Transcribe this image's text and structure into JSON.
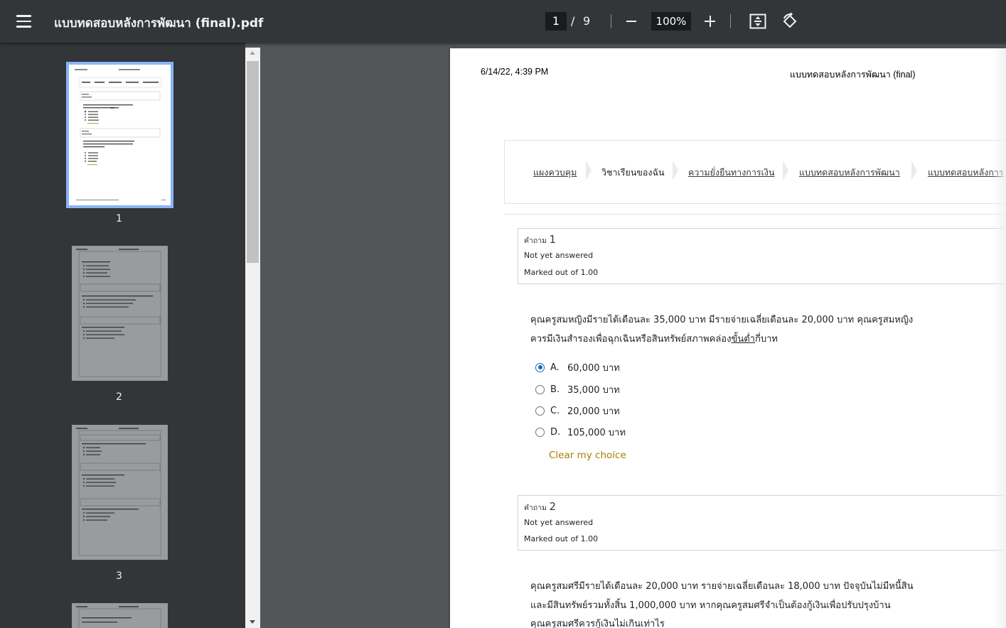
{
  "toolbar": {
    "title": "แบบทดสอบหลังการพัฒนา (final).pdf",
    "current_page": "1",
    "page_separator": "/",
    "total_pages": "9",
    "zoom": "100%"
  },
  "sidebar": {
    "thumbnails": [
      {
        "label": "1",
        "active": true
      },
      {
        "label": "2",
        "active": false
      },
      {
        "label": "3",
        "active": false
      }
    ]
  },
  "page": {
    "header_date": "6/14/22, 4:39 PM",
    "header_title": "แบบทดสอบหลังการพัฒนา (final)",
    "breadcrumb": [
      "แผงควบคุม",
      "วิชาเรียนของฉัน",
      "ความยั่งยืนทางการเงิน",
      "แบบทดสอบหลังการพัฒนา",
      "แบบทดสอบหลังการ"
    ],
    "question1": {
      "label": "คำถาม",
      "number": "1",
      "state": "Not yet answered",
      "marks": "Marked out of 1.00",
      "text_line1": "คุณครูสมหญิงมีรายได้เดือนละ 35,000 บาท มีรายจ่ายเฉลี่ยเดือนละ 20,000 บาท คุณครูสมหญิง",
      "text_line2_pre": "ควรมีเงินสำรองเพื่อฉุกเฉินหรือสินทรัพย์สภาพคล่อง",
      "text_line2_underlined": "ขั้นต่ำ",
      "text_line2_post": "กี่บาท",
      "options": [
        {
          "letter": "A.",
          "text": "60,000 บาท",
          "selected": true
        },
        {
          "letter": "B.",
          "text": "35,000 บาท",
          "selected": false
        },
        {
          "letter": "C.",
          "text": "20,000 บาท",
          "selected": false
        },
        {
          "letter": "D.",
          "text": "105,000 บาท",
          "selected": false
        }
      ],
      "clear_label": "Clear my choice"
    },
    "question2": {
      "label": "คำถาม",
      "number": "2",
      "state": "Not yet answered",
      "marks": "Marked out of 1.00",
      "text_line1": "คุณครูสมศรีมีรายได้เดือนละ 20,000 บาท รายจ่ายเฉลี่ยเดือนละ 18,000 บาท ปัจจุบันไม่มีหนี้สิน",
      "text_line2": "และมีสินทรัพย์รวมทั้งสิ้น 1,000,000 บาท หากคุณครูสมศรีจำเป็นต้องกู้เงินเพื่อปรับปรุงบ้าน",
      "text_line3": "คุณครูสมศรีควรกู้เงินไม่เกินเท่าไร"
    }
  }
}
